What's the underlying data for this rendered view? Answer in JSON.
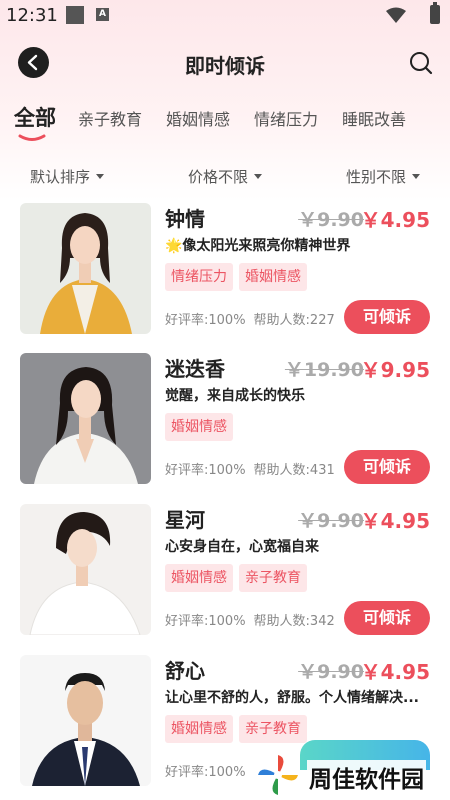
{
  "status_bar": {
    "time": "12:31",
    "badge_letter": "A"
  },
  "header": {
    "title": "即时倾诉"
  },
  "tabs": [
    {
      "label": "全部",
      "active": true
    },
    {
      "label": "亲子教育",
      "active": false
    },
    {
      "label": "婚姻情感",
      "active": false
    },
    {
      "label": "情绪压力",
      "active": false
    },
    {
      "label": "睡眠改善",
      "active": false
    }
  ],
  "filters": [
    {
      "label": "默认排序"
    },
    {
      "label": "价格不限"
    },
    {
      "label": "性别不限"
    }
  ],
  "counselors": [
    {
      "name": "钟情",
      "old_price": "￥9.90",
      "price": "￥4.95",
      "motto": "🌟像太阳光来照亮你精神世界",
      "tags": [
        "情绪压力",
        "婚姻情感"
      ],
      "rating": "好评率:100%",
      "helped": "帮助人数:227",
      "button": "可倾诉"
    },
    {
      "name": "迷迭香",
      "old_price": "￥19.90",
      "price": "￥9.95",
      "motto": "觉醒，来自成长的快乐",
      "tags": [
        "婚姻情感"
      ],
      "rating": "好评率:100%",
      "helped": "帮助人数:431",
      "button": "可倾诉"
    },
    {
      "name": "星河",
      "old_price": "￥9.90",
      "price": "￥4.95",
      "motto": "心安身自在，心宽福自来",
      "tags": [
        "婚姻情感",
        "亲子教育"
      ],
      "rating": "好评率:100%",
      "helped": "帮助人数:342",
      "button": "可倾诉"
    },
    {
      "name": "舒心",
      "old_price": "￥9.90",
      "price": "￥4.95",
      "motto": "让心里不舒的人，舒服。个人情绪解决...",
      "tags": [
        "婚姻情感",
        "亲子教育"
      ],
      "rating": "好评率:100%",
      "helped": "",
      "button": ""
    }
  ],
  "watermark": {
    "text": "周佳软件园"
  },
  "colors": {
    "accent": "#ec4f5c",
    "tag_bg": "#fde6e8",
    "tag_text": "#ec5563"
  }
}
